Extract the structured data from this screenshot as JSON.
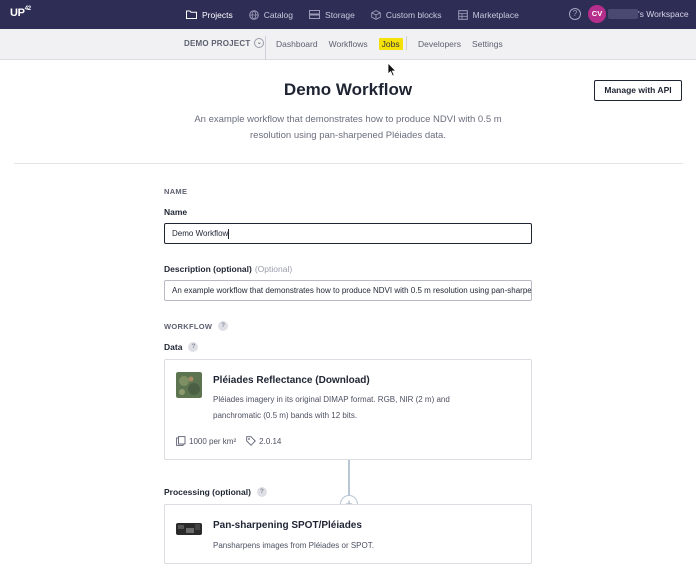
{
  "topbar": {
    "logo": "UP",
    "logo_sup": "42",
    "nav": [
      {
        "label": "Projects",
        "icon": "folder-icon",
        "active": true
      },
      {
        "label": "Catalog",
        "icon": "globe-icon",
        "active": false
      },
      {
        "label": "Storage",
        "icon": "storage-icon",
        "active": false
      },
      {
        "label": "Custom blocks",
        "icon": "cube-icon",
        "active": false
      },
      {
        "label": "Marketplace",
        "icon": "store-icon",
        "active": false
      }
    ],
    "help": "?",
    "avatar_initials": "CV",
    "workspace_label": "'s Workspace"
  },
  "subbar": {
    "project": "DEMO PROJECT",
    "links": [
      "Dashboard",
      "Workflows",
      "Jobs",
      "Developers",
      "Settings"
    ],
    "highlighted": "Jobs"
  },
  "page": {
    "title": "Demo Workflow",
    "manage_button": "Manage with API",
    "description": "An example workflow that demonstrates how to produce NDVI with 0.5 m resolution using pan-sharpened Pléiades data."
  },
  "form": {
    "name_section": "NAME",
    "name_label": "Name",
    "name_value": "Demo Workflow",
    "description_label": "Description (optional)",
    "description_optional": "(Optional)",
    "description_value": "An example workflow that demonstrates how to produce NDVI with 0.5 m resolution using pan-sharpened Pléiades data.",
    "workflow_section": "WORKFLOW",
    "data_label": "Data",
    "processing_label": "Processing (optional)"
  },
  "blocks": {
    "data": {
      "title": "Pléiades Reflectance (Download)",
      "description": "Pléiades imagery in its original DIMAP format. RGB, NIR (2 m) and panchromatic (0.5 m) bands with 12 bits.",
      "price": "1000 per km²",
      "version": "2.0.14"
    },
    "processing": {
      "title": "Pan-sharpening SPOT/Pléiades",
      "description": "Pansharpens images from Pléiades or SPOT."
    }
  },
  "colors": {
    "topbar": "#2e2d56",
    "highlight": "#f4e10b",
    "avatar": "#b62e8b"
  }
}
